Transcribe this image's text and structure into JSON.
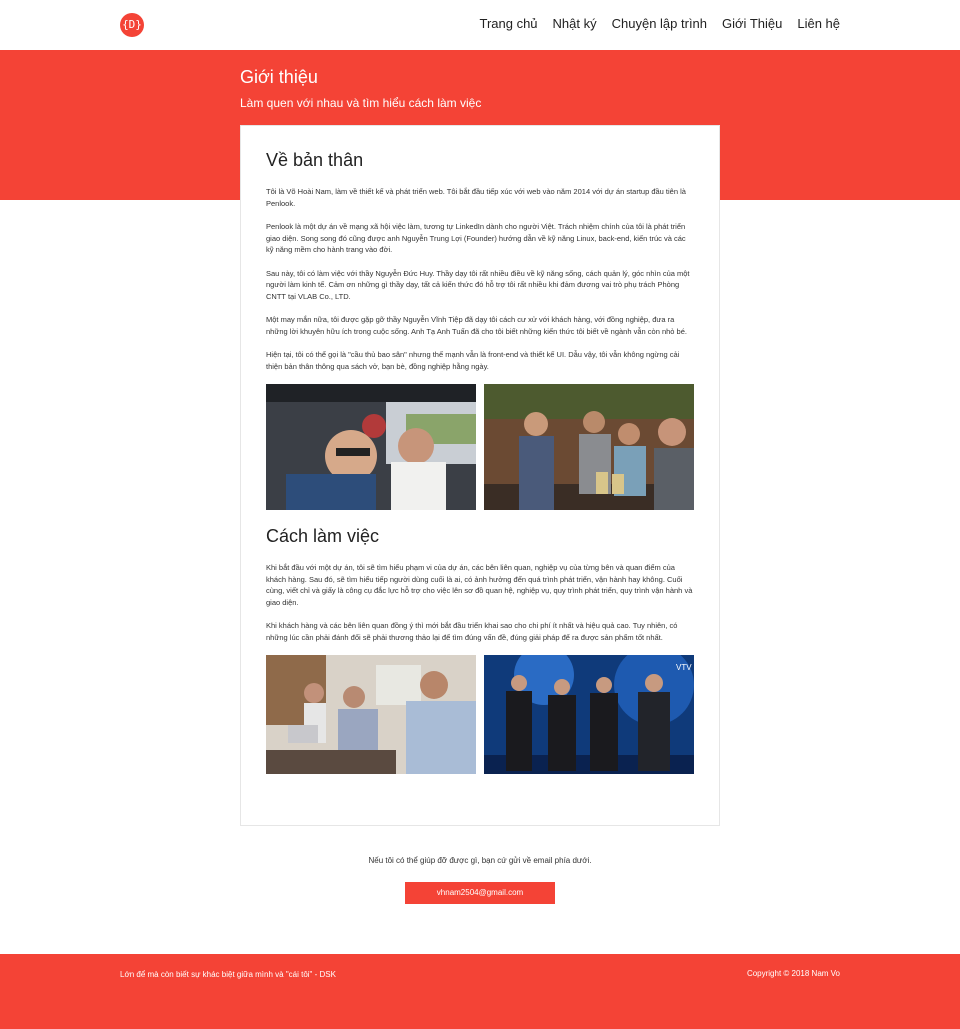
{
  "nav": {
    "logo": "{D}",
    "items": [
      "Trang chủ",
      "Nhật ký",
      "Chuyện lập trình",
      "Giới Thiệu",
      "Liên hệ"
    ]
  },
  "hero": {
    "title": "Giới thiệu",
    "subtitle": "Làm quen với nhau và tìm hiểu cách làm việc"
  },
  "about": {
    "heading": "Về bản thân",
    "paragraphs": [
      "Tôi là Võ Hoài Nam, làm về thiết kế và phát triển web. Tôi bắt đầu tiếp xúc với web vào năm 2014 với dự án startup đầu tiên là Penlook.",
      "Penlook là một dự án về mạng xã hội việc làm, tương tự LinkedIn dành cho người Việt. Trách nhiệm chính của tôi là phát triển giao diện. Song song đó cũng được anh Nguyễn Trung Lợi (Founder) hướng dẫn về kỹ năng Linux, back-end, kiến trúc và các kỹ năng mềm cho hành trang vào đời.",
      "Sau này,  tôi có làm việc với thầy Nguyễn Đức Huy. Thầy dạy tôi rất nhiều điều về kỹ năng sống, cách quản lý, góc nhìn của một người làm kinh tế. Cảm ơn những gì thầy dạy, tất cả kiến thức đó hỗ trợ tôi rất nhiều khi đảm đương vai trò phụ trách Phòng CNTT tại VLAB Co., LTD.",
      "Một may mắn nữa, tôi được gặp gỡ thầy Nguyễn Vĩnh Tiệp đã dạy tôi cách cư xử với khách hàng, với đồng nghiệp, đưa ra những lời khuyên hữu ích trong cuộc sống. Anh Tạ Anh Tuấn đã cho tôi biết những kiến thức tôi biết về ngành vẫn còn nhỏ bé.",
      "Hiện tại, tôi có thể gọi là \"cầu thủ bao sân\" nhưng thế mạnh vẫn là front-end và thiết kế UI. Dẫu vậy, tôi vẫn không ngừng cải thiện bản thân thông qua sách vở, bạn bè, đồng nghiệp hằng ngày."
    ]
  },
  "work": {
    "heading": "Cách làm việc",
    "paragraphs": [
      "Khi bắt đầu với một dự án, tôi sẽ tìm hiểu phạm vi của dự án, các bên liên quan, nghiệp vụ của từng bên và quan điểm của khách hàng. Sau đó, sẽ tìm hiểu tiếp người dùng cuối là ai, có ảnh hưởng đến quá trình phát triển, vận hành hay không. Cuối cùng, viết chỉ và giấy là công cụ đắc lực hỗ trợ cho việc lên sơ đồ quan hệ, nghiệp vụ, quy trình phát triển, quy trình vận hành và giao diện.",
      "Khi khách hàng và các bên liên quan đồng ý thì mới bắt đầu triển khai sao cho chi phí ít nhất và hiệu quả cao. Tuy nhiên, có những lúc cần phải đánh đổi sẽ phải thương thảo lại để tìm đúng vấn đề, đúng giải pháp để ra được sản phẩm tốt nhất."
    ]
  },
  "contact": {
    "text": "Nếu tôi có thể giúp đỡ được gì, bạn cứ gửi về email phía dưới.",
    "email": "vhnam2504@gmail.com"
  },
  "footer": {
    "left": "Lớn để mà còn biết sự khác biệt giữa mình và \"cái tôi\" - DSK",
    "right": "Copyright © 2018 Nam Vo"
  },
  "colors": {
    "accent": "#f44336"
  }
}
